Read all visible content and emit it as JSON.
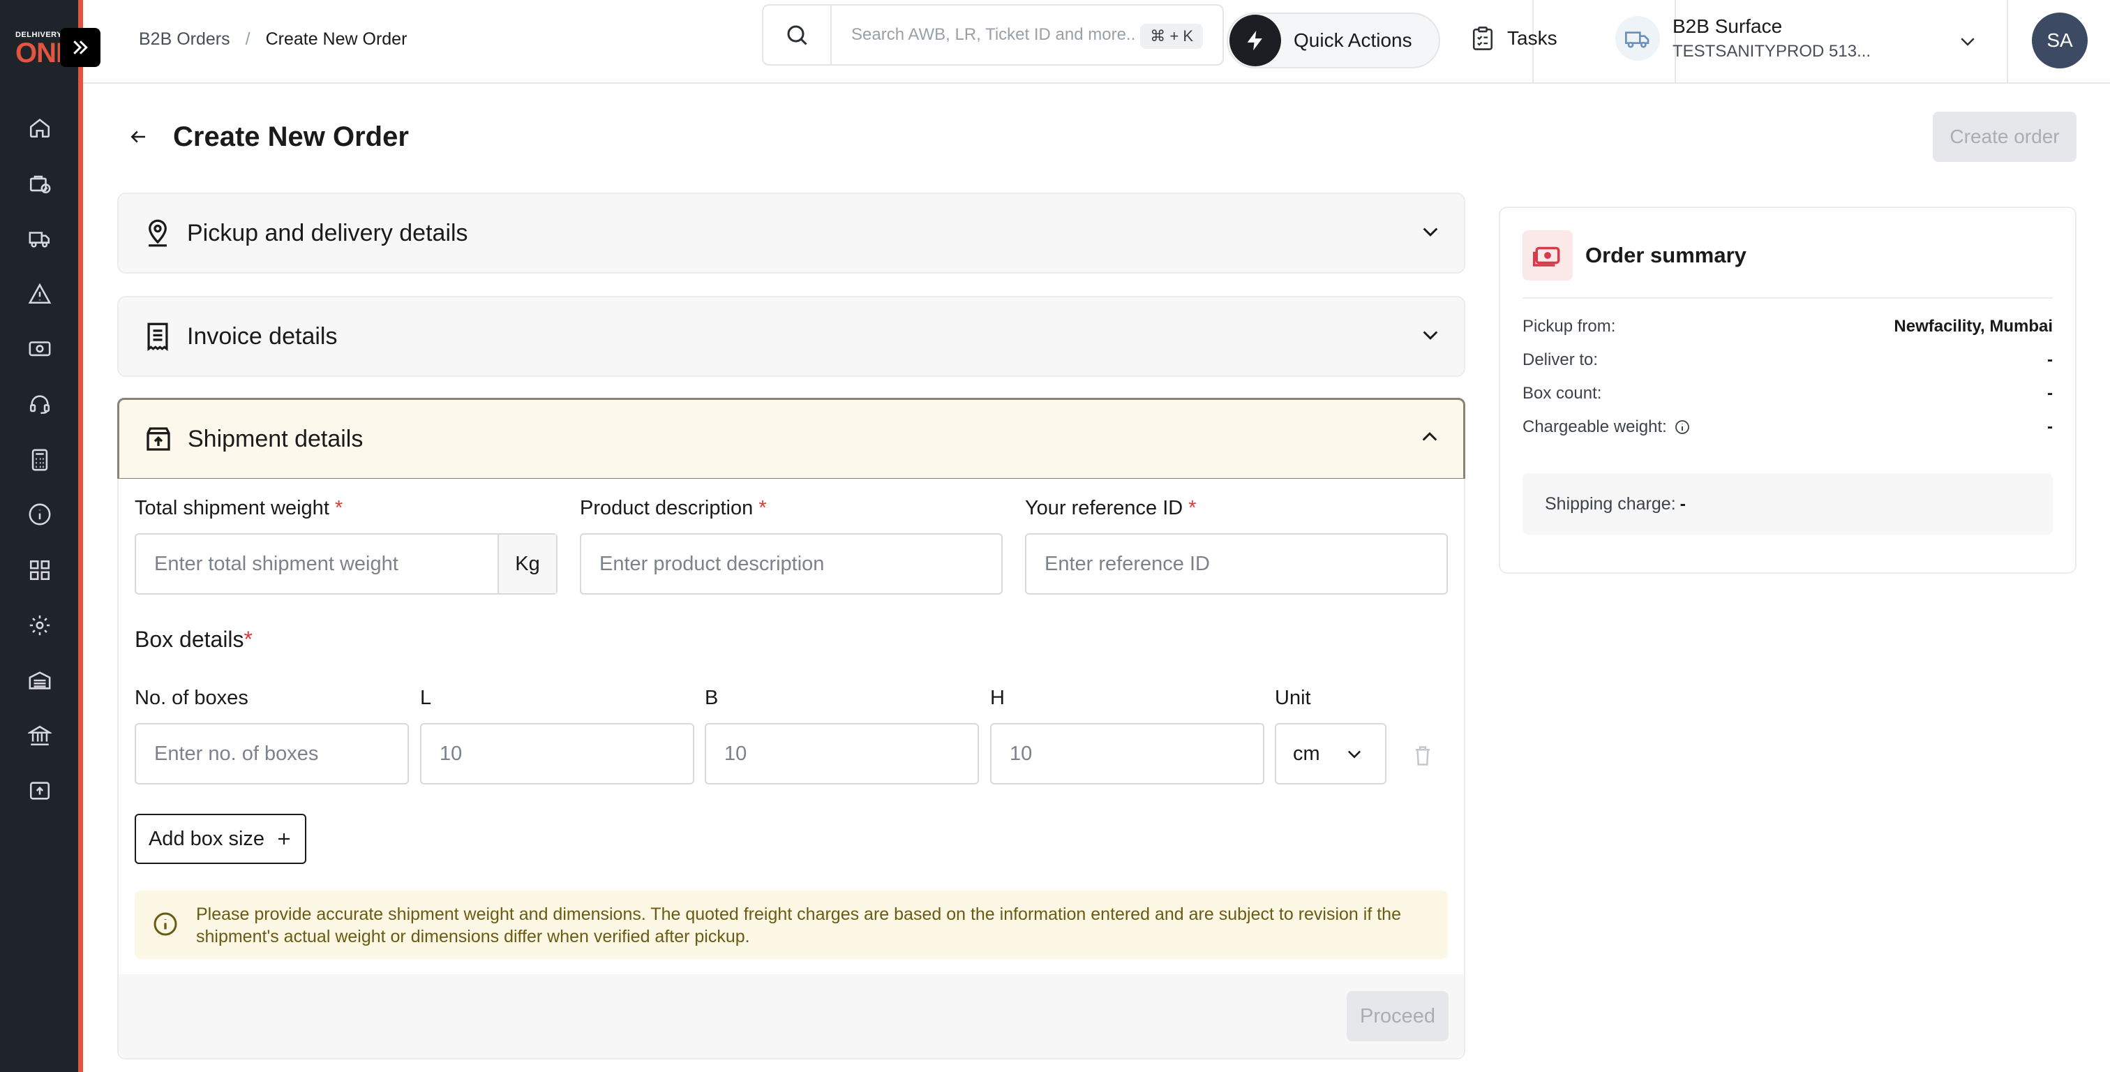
{
  "brand": {
    "logo_top": "DELHIVERY",
    "logo_main": "ONE",
    "accent": "#e2553f"
  },
  "sidebar": {
    "items": [
      {
        "name": "home-icon"
      },
      {
        "name": "orders-icon"
      },
      {
        "name": "truck-icon"
      },
      {
        "name": "alert-icon"
      },
      {
        "name": "payments-icon"
      },
      {
        "name": "support-icon"
      },
      {
        "name": "calculator-icon"
      },
      {
        "name": "info-icon"
      },
      {
        "name": "apps-icon"
      },
      {
        "name": "settings-icon"
      },
      {
        "name": "warehouse-icon"
      },
      {
        "name": "bank-icon"
      },
      {
        "name": "upload-icon"
      }
    ]
  },
  "header": {
    "breadcrumb": [
      "B2B Orders",
      "Create New Order"
    ],
    "search_placeholder": "Search AWB, LR, Ticket ID and more..",
    "search_shortcut": "⌘ + K",
    "quick_actions": "Quick Actions",
    "tasks": "Tasks",
    "account_name": "B2B Surface",
    "account_sub": "TESTSANITYPROD 513...",
    "avatar_initials": "SA"
  },
  "page": {
    "title": "Create New Order",
    "create_button": "Create order"
  },
  "sections": {
    "pickup": "Pickup and delivery details",
    "invoice": "Invoice details",
    "shipment": "Shipment details"
  },
  "shipment": {
    "weight_label": "Total shipment weight",
    "weight_placeholder": "Enter total shipment weight",
    "weight_unit": "Kg",
    "product_label": "Product description",
    "product_placeholder": "Enter product description",
    "ref_label": "Your reference ID",
    "ref_placeholder": "Enter reference ID",
    "required_mark": "*",
    "box_details_label": "Box details",
    "boxes_label": "No. of boxes",
    "boxes_placeholder": "Enter no. of boxes",
    "l_label": "L",
    "b_label": "B",
    "h_label": "H",
    "unit_label": "Unit",
    "l_value": "10",
    "b_value": "10",
    "h_value": "10",
    "unit_value": "cm",
    "add_box": "Add box size",
    "notice": "Please provide accurate shipment weight and dimensions. The quoted freight charges are based on the information entered and are subject to revision if the shipment's actual weight or dimensions differ when verified after pickup.",
    "proceed": "Proceed"
  },
  "summary": {
    "title": "Order summary",
    "rows": [
      {
        "label": "Pickup from:",
        "value": "Newfacility, Mumbai"
      },
      {
        "label": "Deliver to:",
        "value": "-"
      },
      {
        "label": "Box count:",
        "value": "-"
      },
      {
        "label": "Chargeable weight:",
        "value": "-"
      }
    ],
    "shipping_label": "Shipping charge:",
    "shipping_value": "-"
  }
}
